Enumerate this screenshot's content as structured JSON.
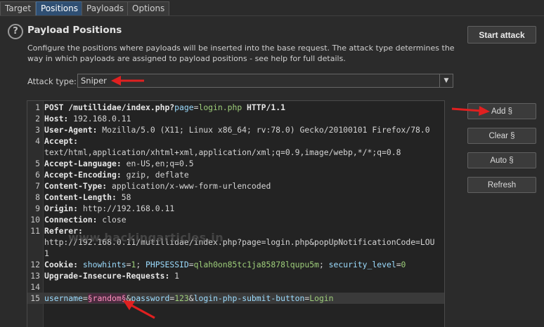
{
  "tabs": [
    {
      "label": "Target"
    },
    {
      "label": "Positions",
      "active": true
    },
    {
      "label": "Payloads"
    },
    {
      "label": "Options"
    }
  ],
  "section": {
    "title": "Payload Positions",
    "description": "Configure the positions where payloads will be inserted into the base request. The attack type determines the way in which payloads are assigned to payload positions - see help for full details."
  },
  "attack": {
    "label": "Attack type:",
    "value": "Sniper"
  },
  "buttons": {
    "start_attack": "Start attack",
    "add": "Add §",
    "clear": "Clear §",
    "auto": "Auto §",
    "refresh": "Refresh"
  },
  "watermark": "www.hackingarticles.in",
  "request_lines": [
    {
      "n": "1",
      "segs": [
        [
          "hk",
          "POST /mutillidae/index.php?"
        ],
        [
          "pk",
          "page"
        ],
        [
          "t",
          "="
        ],
        [
          "pv",
          "login.php"
        ],
        [
          "hk",
          " HTTP/1.1"
        ]
      ]
    },
    {
      "n": "2",
      "segs": [
        [
          "hk",
          "Host:"
        ],
        [
          "t",
          " 192.168.0.11"
        ]
      ]
    },
    {
      "n": "3",
      "segs": [
        [
          "hk",
          "User-Agent:"
        ],
        [
          "t",
          " Mozilla/5.0 (X11; Linux x86_64; rv:78.0) Gecko/20100101 Firefox/78.0"
        ]
      ]
    },
    {
      "n": "4",
      "segs": [
        [
          "hk",
          "Accept:"
        ]
      ]
    },
    {
      "n": "",
      "segs": [
        [
          "t",
          "text/html,application/xhtml+xml,application/xml;q=0.9,image/webp,*/*;q=0.8"
        ]
      ]
    },
    {
      "n": "5",
      "segs": [
        [
          "hk",
          "Accept-Language:"
        ],
        [
          "t",
          " en-US,en;q=0.5"
        ]
      ]
    },
    {
      "n": "6",
      "segs": [
        [
          "hk",
          "Accept-Encoding:"
        ],
        [
          "t",
          " gzip, deflate"
        ]
      ]
    },
    {
      "n": "7",
      "segs": [
        [
          "hk",
          "Content-Type:"
        ],
        [
          "t",
          " application/x-www-form-urlencoded"
        ]
      ]
    },
    {
      "n": "8",
      "segs": [
        [
          "hk",
          "Content-Length:"
        ],
        [
          "t",
          " 58"
        ]
      ]
    },
    {
      "n": "9",
      "segs": [
        [
          "hk",
          "Origin:"
        ],
        [
          "t",
          " http://192.168.0.11"
        ]
      ]
    },
    {
      "n": "10",
      "segs": [
        [
          "hk",
          "Connection:"
        ],
        [
          "t",
          " close"
        ]
      ]
    },
    {
      "n": "11",
      "segs": [
        [
          "hk",
          "Referer:"
        ]
      ]
    },
    {
      "n": "",
      "segs": [
        [
          "t",
          "http://192.168.0.11/mutillidae/index.php?page=login.php&popUpNotificationCode=LOU"
        ]
      ]
    },
    {
      "n": "",
      "segs": [
        [
          "t",
          "1"
        ]
      ]
    },
    {
      "n": "12",
      "segs": [
        [
          "hk",
          "Cookie:"
        ],
        [
          "t",
          " "
        ],
        [
          "pk",
          "showhints"
        ],
        [
          "t",
          "="
        ],
        [
          "pv",
          "1"
        ],
        [
          "t",
          "; "
        ],
        [
          "pk",
          "PHPSESSID"
        ],
        [
          "t",
          "="
        ],
        [
          "pv",
          "qlah0on85tc1ja85878lqupu5m"
        ],
        [
          "t",
          "; "
        ],
        [
          "pk",
          "security_level"
        ],
        [
          "t",
          "="
        ],
        [
          "pv",
          "0"
        ]
      ]
    },
    {
      "n": "13",
      "segs": [
        [
          "hk",
          "Upgrade-Insecure-Requests:"
        ],
        [
          "t",
          " 1"
        ]
      ]
    },
    {
      "n": "14",
      "segs": []
    },
    {
      "n": "15",
      "current": true,
      "segs": [
        [
          "pk",
          "username"
        ],
        [
          "t",
          "="
        ],
        [
          "pm",
          "§random§"
        ],
        [
          "t",
          "&"
        ],
        [
          "pk",
          "password"
        ],
        [
          "t",
          "="
        ],
        [
          "pv",
          "123"
        ],
        [
          "t",
          "&"
        ],
        [
          "pk",
          "login-php-submit-button"
        ],
        [
          "t",
          "="
        ],
        [
          "pv",
          "Login"
        ]
      ]
    }
  ],
  "colors": {
    "accent_tab": "#2f4f73",
    "annotation_arrow": "#e02020",
    "payload_marker": "#ff8fbf"
  },
  "icons": {
    "help": "help-circle-icon",
    "dropdown": "chevron-down-icon",
    "annotation": "red-arrow-annotation"
  }
}
